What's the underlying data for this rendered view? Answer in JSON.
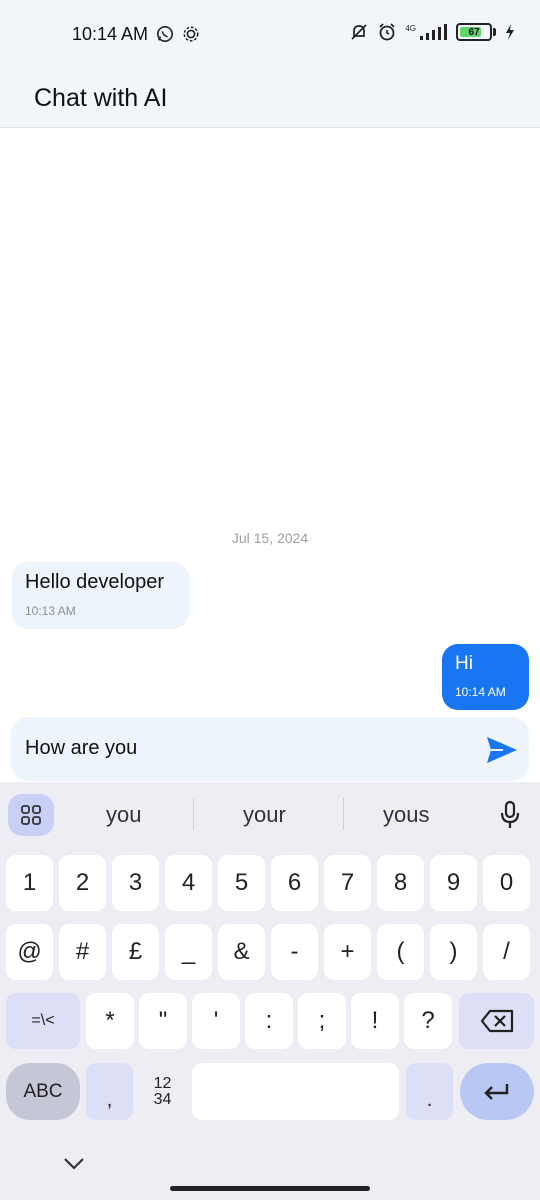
{
  "status_bar": {
    "time": "10:14 AM",
    "network": "4G",
    "battery": "67",
    "battery_level": 0.67
  },
  "app_bar": {
    "title": "Chat with AI"
  },
  "chat": {
    "date_separator": "Jul 15, 2024",
    "messages": [
      {
        "direction": "incoming",
        "text": "Hello developer",
        "time": "10:13 AM"
      },
      {
        "direction": "outgoing",
        "text": "Hi",
        "time": "10:14 AM"
      }
    ]
  },
  "composer": {
    "value": "How are you",
    "send_icon": "send-icon"
  },
  "keyboard": {
    "suggestions": [
      "you",
      "your",
      "yous"
    ],
    "row1": [
      "1",
      "2",
      "3",
      "4",
      "5",
      "6",
      "7",
      "8",
      "9",
      "0"
    ],
    "row2": [
      "@",
      "#",
      "£",
      "_",
      "&",
      "-",
      "+",
      "(",
      ")",
      "/"
    ],
    "row3": [
      "=\\<",
      "*",
      "\"",
      "'",
      ":",
      ";",
      "!",
      "?"
    ],
    "row4": {
      "abc": "ABC",
      "comma": ",",
      "numpad_top": "12",
      "numpad_bottom": "34",
      "period": "."
    }
  },
  "colors": {
    "accent": "#1976f2",
    "bubble_in": "#eef4fb",
    "keyboard_bg": "#eeedf4"
  }
}
